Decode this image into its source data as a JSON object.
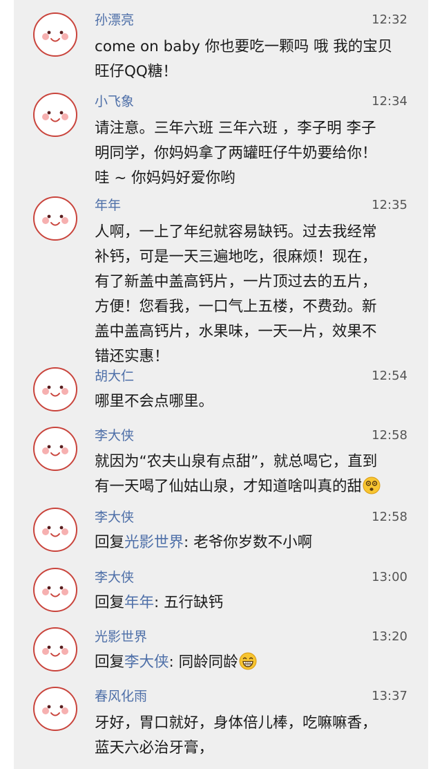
{
  "comments": [
    {
      "name": "孙漂亮",
      "time": "12:32",
      "lines": [
        "come on baby 你也要吃一颗吗 哦 我的宝贝",
        "旺仔QQ糖！"
      ]
    },
    {
      "name": "小飞象",
      "time": "12:34",
      "lines": [
        "请注意。三年六班 三年六班 ，李子明 李子",
        "明同学，你妈妈拿了两罐旺仔牛奶要给你！",
        "哇 ~ 你妈妈好爱你哟"
      ]
    },
    {
      "name": "年年",
      "time": "12:35",
      "lines": [
        "人啊，一上了年纪就容易缺钙。过去我经常",
        "补钙，可是一天三遍地吃，很麻烦！现在，",
        "有了新盖中盖高钙片，一片顶过去的五片，",
        "方便！您看我，一口气上五楼，不费劲。新",
        "盖中盖高钙片，水果味，一天一片，效果不",
        "错还实惠！"
      ]
    },
    {
      "name": "胡大仁",
      "time": "12:54",
      "lines": [
        "哪里不会点哪里。"
      ]
    },
    {
      "name": "李大侠",
      "time": "12:58",
      "lines": [
        "就因为“农夫山泉有点甜”，就总喝它，直到",
        "有一天喝了仙姑山泉，才知道啥叫真的甜"
      ],
      "emoji": "dizzy-face-emoji"
    },
    {
      "name": "李大侠",
      "time": "12:58",
      "reply_prefix": "回复",
      "reply_to": "光影世界",
      "reply_text": ": 老爷你岁数不小啊"
    },
    {
      "name": "李大侠",
      "time": "13:00",
      "reply_prefix": "回复",
      "reply_to": "年年",
      "reply_text": ": 五行缺钙"
    },
    {
      "name": "光影世界",
      "time": "13:20",
      "reply_prefix": "回复",
      "reply_to": "李大侠",
      "reply_text": ": 同龄同龄",
      "emoji": "grinning-face-emoji"
    },
    {
      "name": "春风化雨",
      "time": "13:37",
      "lines": [
        "牙好，胃口就好，身体倍儿棒，吃嘛嘛香，",
        "蓝天六必治牙膏，"
      ]
    }
  ],
  "colors": {
    "background": "#efefef",
    "name": "#4e6fa8",
    "time": "#555555",
    "text": "#1a1a1a",
    "avatar_border": "#c9443c"
  }
}
